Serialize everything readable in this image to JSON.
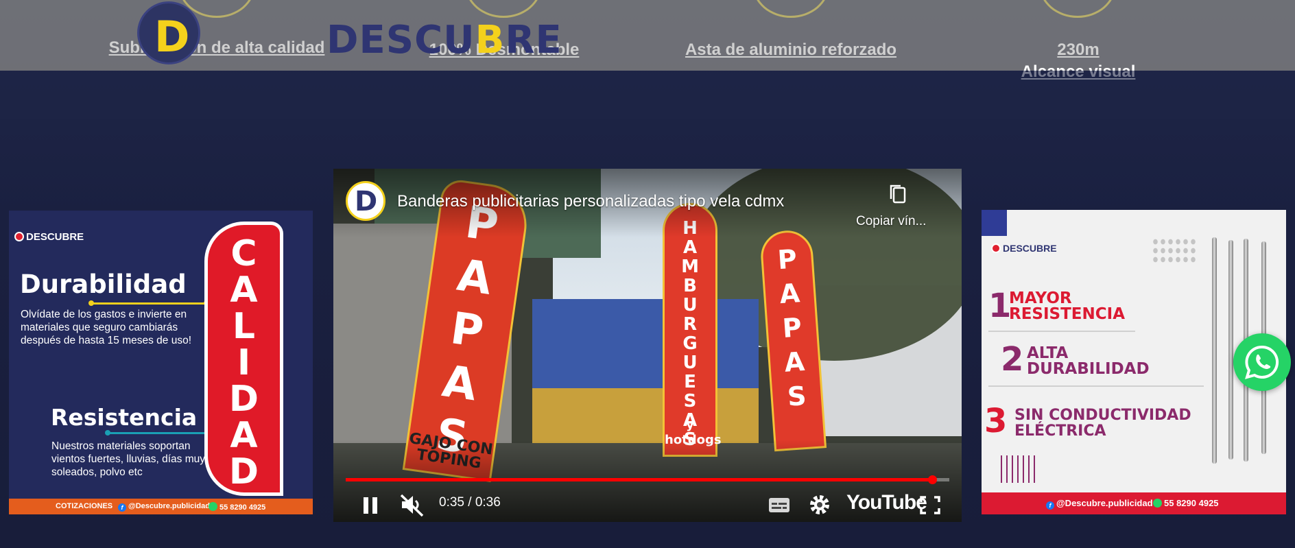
{
  "header": {
    "logo_letter": "D",
    "logo_word_parts": [
      "DESCU",
      "B",
      "RE"
    ],
    "features": [
      {
        "label": "Sublimación de alta calidad"
      },
      {
        "label": "100% Desmontable"
      },
      {
        "label": "Asta de aluminio reforzado"
      },
      {
        "label_line1": "230m",
        "label_line2": "Alcance visual"
      }
    ]
  },
  "left_banner": {
    "brand": "DESCUBRE",
    "heading1": "Durabilidad",
    "text1": "Olvídate de los gastos e invierte en materiales que seguro cambiarás después de hasta 15 meses de uso!",
    "heading2": "Resistencia",
    "text2": "Nuestros materiales soportan vientos fuertes, lluvias, días muy soleados, polvo etc",
    "flag_word": "CALIDAD",
    "footer": {
      "cotizaciones": "COTIZACIONES",
      "facebook": "@Descubre.publicidad",
      "phone": "55 8290 4925"
    },
    "colors": {
      "background": "#232a5c",
      "flag": "#e01a28",
      "footer": "#e45d1d",
      "accent1": "#f4d11c",
      "accent2": "#1aa0b4"
    }
  },
  "video": {
    "channel_letter": "D",
    "title": "Banderas publicitarias personalizadas tipo vela cdmx",
    "copy_link_label": "Copiar vín...",
    "current_time": "0:35",
    "duration": "0:36",
    "time_display": "0:35 / 0:36",
    "progress": 0.972,
    "youtube_label": "YouTube",
    "state": "playing",
    "muted": true,
    "scene_flags": [
      {
        "text": "PAPAS",
        "footer": "GAJO CON TOPING"
      },
      {
        "text": "HAMBURGUESAS",
        "footer": "y hotdogs"
      },
      {
        "text": "PAPAS"
      }
    ],
    "icons": [
      "copy-icon",
      "pause-icon",
      "muted-volume-icon",
      "subtitles-icon",
      "settings-gear-icon",
      "fullscreen-icon"
    ]
  },
  "right_banner": {
    "brand": "DESCUBRE",
    "items": [
      {
        "num": "1",
        "line1": "MAYOR",
        "line2": "RESISTENCIA"
      },
      {
        "num": "2",
        "line1": "ALTA",
        "line2": "DURABILIDAD"
      },
      {
        "num": "3",
        "line1": "SIN CONDUCTIVIDAD",
        "line2": "ELÉCTRICA"
      }
    ],
    "footer": {
      "facebook": "@Descubre.publicidad",
      "phone": "55 8290 4925"
    },
    "colors": {
      "number": "#8b2a6b",
      "text_red": "#dc1a32",
      "footer": "#dc1a32",
      "corner": "#2f3c96"
    }
  },
  "whatsapp_button": {
    "icon": "whatsapp-icon",
    "color": "#25d366"
  }
}
